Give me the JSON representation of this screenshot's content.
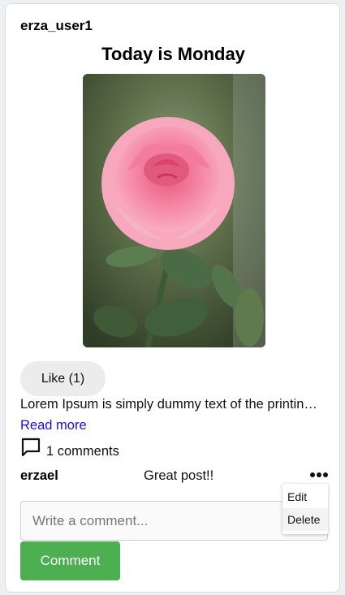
{
  "post": {
    "username": "erza_user1",
    "title": "Today is Monday",
    "image_alt": "pink rose",
    "like_label": "Like (1)",
    "body": "Lorem Ipsum is simply dummy text of the printing and typesetting industry.",
    "read_more": "Read more",
    "comments_count": "1 comments"
  },
  "comments": [
    {
      "author": "erzael",
      "text": "Great post!!"
    }
  ],
  "comment_menu": {
    "icon": "more-horizontal-icon",
    "items": [
      "Edit",
      "Delete"
    ]
  },
  "comment_form": {
    "placeholder": "Write a comment...",
    "submit_label": "Comment"
  },
  "colors": {
    "submit": "#4caf50",
    "link": "#1a0dde",
    "like_bg": "#ececec"
  }
}
